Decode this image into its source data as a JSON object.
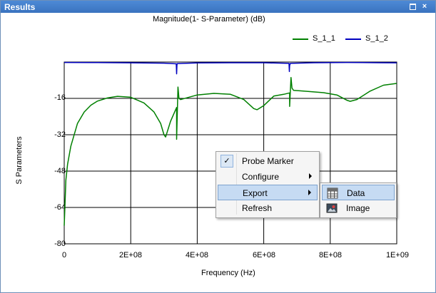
{
  "window": {
    "title": "Results",
    "maximize_icon": "maximize-icon",
    "close_label": "×"
  },
  "chart_data": {
    "type": "line",
    "title": "Magnitude(1- S-Parameter) (dB)",
    "xlabel": "Frequency (Hz)",
    "ylabel": "S Parameters",
    "xlim": [
      0,
      1000000000
    ],
    "ylim": [
      -80,
      0
    ],
    "yticks": [
      -16,
      -32,
      -48,
      -64,
      -80
    ],
    "ytick_labels": [
      "-16",
      "-32",
      "-48",
      "-64",
      "-80"
    ],
    "xticks": [
      0,
      200000000,
      400000000,
      600000000,
      800000000,
      1000000000
    ],
    "xtick_labels": [
      "0",
      "2E+08",
      "4E+08",
      "6E+08",
      "8E+08",
      "1E+09"
    ],
    "grid": true,
    "legend_position": "top-right",
    "series": [
      {
        "name": "S_1_1",
        "color": "#008000",
        "x": [
          0,
          5000000,
          10000000,
          20000000,
          40000000,
          60000000,
          80000000,
          100000000,
          130000000,
          160000000,
          200000000,
          240000000,
          270000000,
          290000000,
          300000000,
          305000000,
          320000000,
          335000000,
          338000000,
          338000000,
          342000000,
          345000000,
          350000000,
          400000000,
          450000000,
          500000000,
          540000000,
          570000000,
          580000000,
          600000000,
          630000000,
          660000000,
          678000000,
          678000000,
          682000000,
          685000000,
          690000000,
          720000000,
          780000000,
          820000000,
          850000000,
          860000000,
          880000000,
          920000000,
          960000000,
          1000000000
        ],
        "y": [
          -72,
          -52,
          -45,
          -37,
          -27,
          -22,
          -19,
          -17.2,
          -15.8,
          -15.1,
          -15.5,
          -18,
          -22,
          -27,
          -32,
          -33,
          -26,
          -21,
          -20,
          -34,
          -11,
          -16,
          -16.5,
          -14.5,
          -13.8,
          -14.2,
          -16.5,
          -20.5,
          -21,
          -19.2,
          -15,
          -14.2,
          -13.6,
          -19.5,
          -6.8,
          -11.5,
          -12.5,
          -12.8,
          -13.5,
          -14.5,
          -16.8,
          -17.3,
          -16.5,
          -12.8,
          -10.2,
          -9.4
        ]
      },
      {
        "name": "S_1_2",
        "color": "#0000c0",
        "x": [
          0,
          100000000,
          200000000,
          300000000,
          337000000,
          338000000,
          339000000,
          340000000,
          400000000,
          500000000,
          600000000,
          676000000,
          677000000,
          678000000,
          680000000,
          750000000,
          850000000,
          950000000,
          1000000000
        ],
        "y": [
          -0.2,
          -0.25,
          -0.35,
          -0.5,
          -0.8,
          -5.2,
          -1.2,
          -0.7,
          -0.4,
          -0.3,
          -0.3,
          -0.6,
          -4.2,
          -1.5,
          -0.6,
          -0.3,
          -0.2,
          -0.3,
          -0.35
        ]
      }
    ]
  },
  "context_menu": {
    "items": [
      {
        "label": "Probe Marker",
        "checked": true,
        "check_glyph": "✓"
      },
      {
        "label": "Configure",
        "submenu": true
      },
      {
        "label": "Export",
        "submenu": true,
        "active": true
      },
      {
        "label": "Refresh"
      }
    ]
  },
  "submenu": {
    "items": [
      {
        "label": "Data",
        "icon": "data-table-icon",
        "active": true
      },
      {
        "label": "Image",
        "icon": "image-icon"
      }
    ]
  }
}
